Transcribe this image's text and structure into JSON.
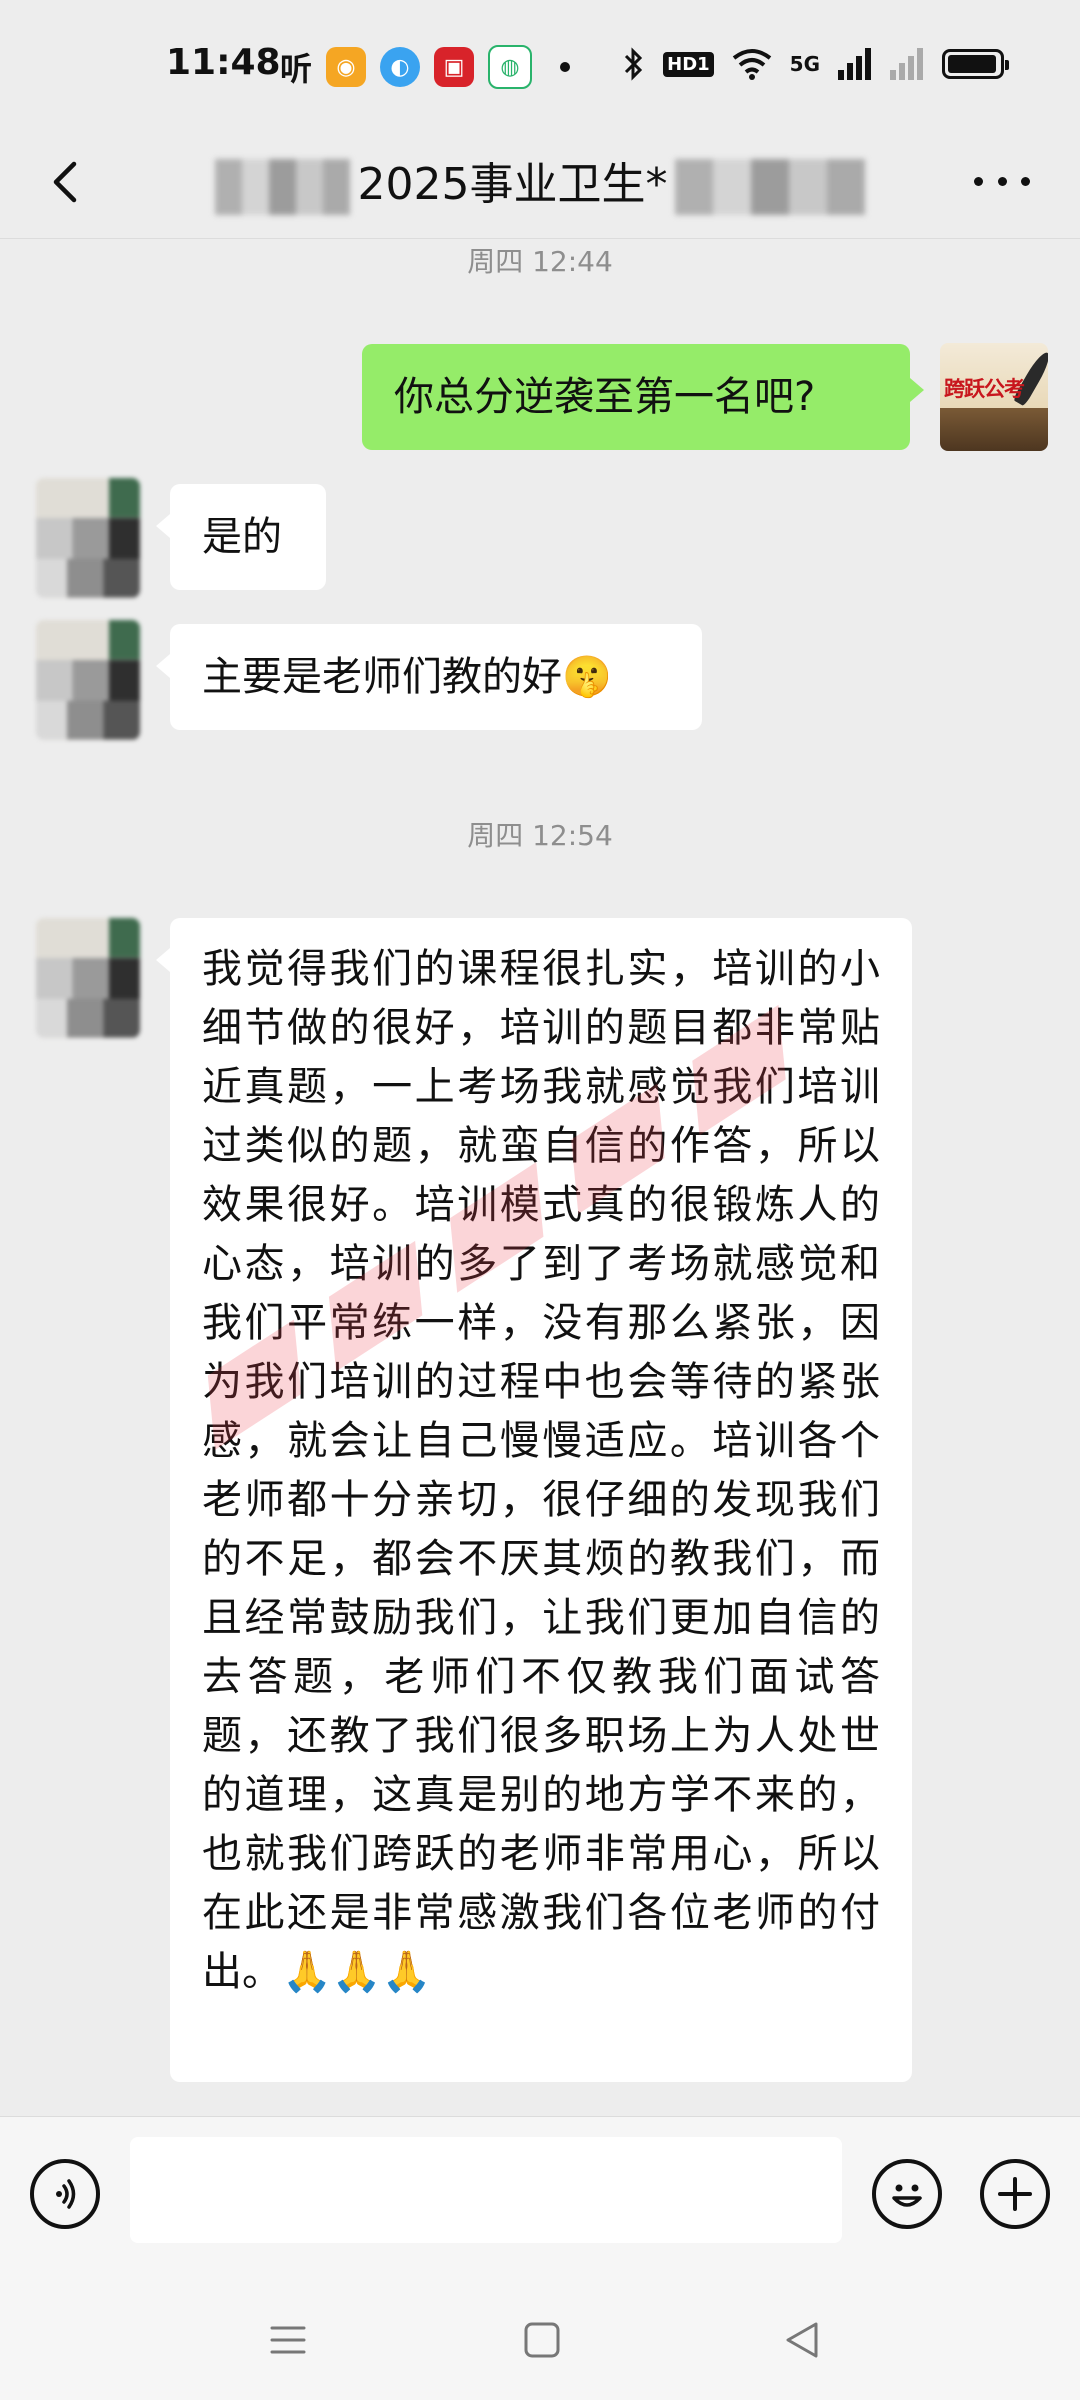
{
  "status_bar": {
    "time": "11:48",
    "listen_icon": "听",
    "hd_label": "HD1",
    "network_label": "5G",
    "battery_level": 0.95,
    "colors": {
      "weibo": "#f5a623",
      "browser": "#3aa3f0",
      "bank": "#d8232a",
      "mobile": "#29b36b"
    }
  },
  "nav": {
    "title_visible": "2025事业卫生*",
    "back_icon": "chevron-left-icon",
    "more_icon": "more-dots-icon"
  },
  "chat": {
    "timestamp_1": "周四 12:44",
    "msg_sent_1": "你总分逆袭至第一名吧?",
    "my_avatar_text": "跨跃公考",
    "msg_recv_1": "是的",
    "msg_recv_2": "主要是老师们教的好",
    "msg_recv_2_emoji": "🤫",
    "timestamp_2": "周四 12:54",
    "msg_recv_3": "我觉得我们的课程很扎实，培训的小细节做的很好，培训的题目都非常贴近真题，一上考场我就感觉我们培训过类似的题，就蛮自信的作答，所以效果很好。培训模式真的很锻炼人的心态，培训的多了到了考场就感觉和我们平常练一样，没有那么紧张，因为我们培训的过程中也会等待的紧张感，就会让自己慢慢适应。培训各个老师都十分亲切，很仔细的发现我们的不足，都会不厌其烦的教我们，而且经常鼓励我们，让我们更加自信的去答题，老师们不仅教我们面试答题，还教了我们很多职场上为人处世的道理，这真是别的地方学不来的，也就我们跨跃的老师非常用心，所以在此还是非常感激我们各位老师的付出。",
    "msg_recv_3_emoji": "🙏🙏🙏",
    "bubble_colors": {
      "sent": "#95ec69",
      "received": "#ffffff"
    }
  },
  "input_bar": {
    "voice_icon": "voice-icon",
    "emoji_icon": "emoji-icon",
    "plus_icon": "plus-icon",
    "placeholder": ""
  },
  "system_nav": {
    "menu_icon": "menu-icon",
    "home_icon": "home-icon",
    "back_icon": "back-triangle-icon"
  }
}
